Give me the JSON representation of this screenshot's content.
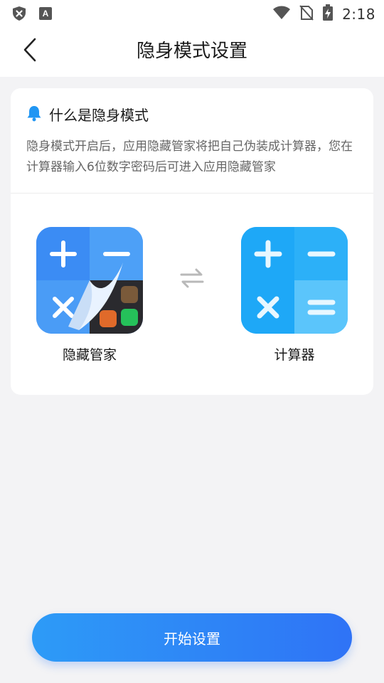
{
  "status_bar": {
    "time": "2:18",
    "left_icons": [
      "shield-close-icon",
      "font-a-icon"
    ],
    "right_icons": [
      "wifi-icon",
      "no-sim-icon",
      "battery-charging-icon"
    ]
  },
  "header": {
    "title": "隐身模式设置",
    "back_icon": "chevron-left-icon"
  },
  "info_card": {
    "icon": "bell-icon",
    "title": "什么是隐身模式",
    "description": "隐身模式开启后，应用隐藏管家将把自己伪装成计算器，您在计算器输入6位数字密码后可进入应用隐藏管家"
  },
  "comparison": {
    "left_app_label": "隐藏管家",
    "right_app_label": "计算器",
    "swap_icon": "swap-arrows-icon"
  },
  "primary_button": {
    "label": "开始设置"
  },
  "colors": {
    "accent": "#2f86f6",
    "bell": "#2196f3",
    "background": "#f3f3f5"
  }
}
